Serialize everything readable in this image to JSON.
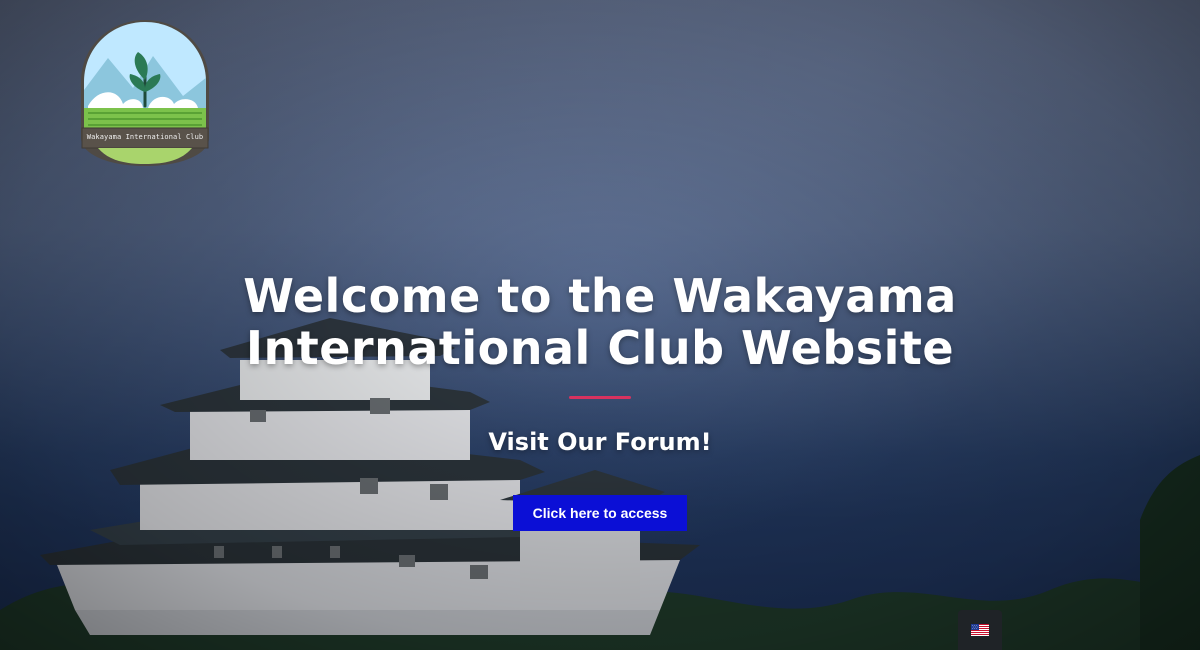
{
  "logo": {
    "text": "Wakayama International Club",
    "icon": "leaf-sprout-mountains-logo"
  },
  "hero": {
    "title": "Welcome to the Wakayama International Club Website",
    "subtitle": "Visit Our Forum!",
    "cta_label": "Click here to access"
  },
  "language_switcher": {
    "icon": "us-flag-icon"
  },
  "colors": {
    "cta": "#0b0fd6",
    "divider": "#d8325f"
  }
}
